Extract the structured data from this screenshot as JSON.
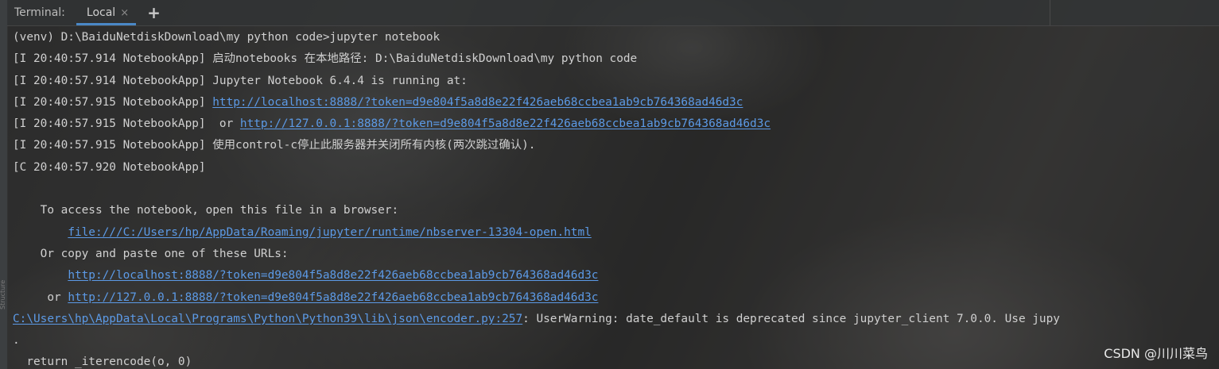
{
  "tab_bar": {
    "title": "Terminal:",
    "active_tab": "Local",
    "close_glyph": "×",
    "add_glyph": "+"
  },
  "side_panel": {
    "label": "Structure"
  },
  "terminal": {
    "lines": [
      [
        {
          "t": "(venv) D:\\BaiduNetdiskDownload\\my python code>jupyter notebook"
        }
      ],
      [
        {
          "t": "[I 20:40:57.914 NotebookApp] 启动notebooks 在本地路径: D:\\BaiduNetdiskDownload\\my python code"
        }
      ],
      [
        {
          "t": "[I 20:40:57.914 NotebookApp] Jupyter Notebook 6.4.4 is running at:"
        }
      ],
      [
        {
          "t": "[I 20:40:57.915 NotebookApp] "
        },
        {
          "t": "http://localhost:8888/?token=d9e804f5a8d8e22f426aeb68ccbea1ab9cb764368ad46d3c",
          "link": true
        }
      ],
      [
        {
          "t": "[I 20:40:57.915 NotebookApp]  or "
        },
        {
          "t": "http://127.0.0.1:8888/?token=d9e804f5a8d8e22f426aeb68ccbea1ab9cb764368ad46d3c",
          "link": true
        }
      ],
      [
        {
          "t": "[I 20:40:57.915 NotebookApp] 使用control-c停止此服务器并关闭所有内核(两次跳过确认)."
        }
      ],
      [
        {
          "t": "[C 20:40:57.920 NotebookApp]"
        }
      ],
      [
        {
          "t": ""
        }
      ],
      [
        {
          "t": "    To access the notebook, open this file in a browser:"
        }
      ],
      [
        {
          "t": "        "
        },
        {
          "t": "file:///C:/Users/hp/AppData/Roaming/jupyter/runtime/nbserver-13304-open.html",
          "link": true
        }
      ],
      [
        {
          "t": "    Or copy and paste one of these URLs:"
        }
      ],
      [
        {
          "t": "        "
        },
        {
          "t": "http://localhost:8888/?token=d9e804f5a8d8e22f426aeb68ccbea1ab9cb764368ad46d3c",
          "link": true
        }
      ],
      [
        {
          "t": "     or "
        },
        {
          "t": "http://127.0.0.1:8888/?token=d9e804f5a8d8e22f426aeb68ccbea1ab9cb764368ad46d3c",
          "link": true
        }
      ],
      [
        {
          "t": "C:\\Users\\hp\\AppData\\Local\\Programs\\Python\\Python39\\lib\\json\\encoder.py:257",
          "link": true
        },
        {
          "t": ": UserWarning: date_default is deprecated since jupyter_client 7.0.0. Use jupy"
        }
      ],
      [
        {
          "t": "."
        }
      ],
      [
        {
          "t": "  return _iterencode(o, 0)"
        }
      ]
    ]
  },
  "watermark": "CSDN @川川菜鸟"
}
